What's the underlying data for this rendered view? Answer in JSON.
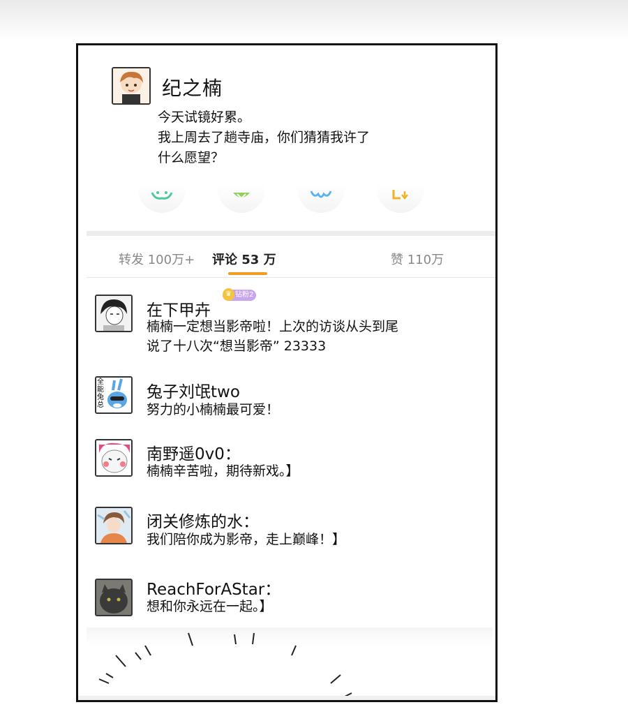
{
  "post": {
    "author": "纪之楠",
    "lines": [
      "今天试镜好累。",
      "我上周去了趟寺庙，你们猜猜我许了",
      "什么愿望？"
    ]
  },
  "tabs": {
    "repost": "转发 100万+",
    "comments": "评论 53 万",
    "likes": "赞 110万"
  },
  "badge": {
    "label": "钻粉2"
  },
  "comments": [
    {
      "name": "在下甲卉",
      "lines": [
        "楠楠一定想当影帝啦！上次的访谈从头到尾",
        "说了十八次“想当影帝” 23333"
      ]
    },
    {
      "name": "兔子刘氓two",
      "lines": [
        "努力的小楠楠最可爱！"
      ],
      "avatar_text": "全能兔总"
    },
    {
      "name": "南野遥0v0：",
      "lines": [
        "楠楠辛苦啦，期待新戏。】"
      ]
    },
    {
      "name": "闭关修炼的水：",
      "lines": [
        "我们陪你成为影帝，走上巅峰！】"
      ]
    },
    {
      "name": "ReachForAStar：",
      "lines": [
        "想和你永远在一起。】"
      ]
    }
  ],
  "colors": {
    "accent": "#f29a26",
    "border": "#111111"
  }
}
